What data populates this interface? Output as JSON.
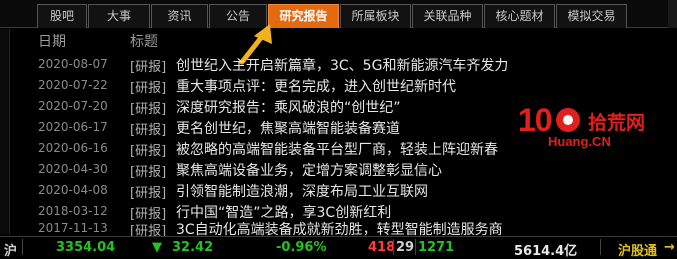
{
  "tabs": [
    {
      "label": "股吧",
      "active": false
    },
    {
      "label": "大事",
      "active": false
    },
    {
      "label": "资讯",
      "active": false
    },
    {
      "label": "公告",
      "active": false
    },
    {
      "label": "研究报告",
      "active": true
    },
    {
      "label": "所属板块",
      "active": false
    },
    {
      "label": "关联品种",
      "active": false
    },
    {
      "label": "核心题材",
      "active": false
    },
    {
      "label": "模拟交易",
      "active": false
    }
  ],
  "table": {
    "col_date": "日期",
    "col_title": "标题",
    "rows": [
      {
        "date": "2020-08-07",
        "tag": "[研报]",
        "title": "创世纪入主开启新篇章，3C、5G和新能源汽车齐发力"
      },
      {
        "date": "2020-07-22",
        "tag": "[研报]",
        "title": "重大事项点评：更名完成，进入创世纪新时代"
      },
      {
        "date": "2020-07-20",
        "tag": "[研报]",
        "title": "深度研究报告：乘风破浪的“创世纪”"
      },
      {
        "date": "2020-06-17",
        "tag": "[研报]",
        "title": "更名创世纪，焦聚高端智能装备赛道"
      },
      {
        "date": "2020-06-16",
        "tag": "[研报]",
        "title": "被忽略的高端智能装备平台型厂商，轻装上阵迎新春"
      },
      {
        "date": "2020-04-30",
        "tag": "[研报]",
        "title": "聚焦高端设备业务，定增方案调整彰显信心"
      },
      {
        "date": "2020-04-08",
        "tag": "[研报]",
        "title": "引领智能制造浪潮，深度布局工业互联网"
      },
      {
        "date": "2018-03-12",
        "tag": "[研报]",
        "title": "行中国“智造”之路，享3C创新红利"
      },
      {
        "date": "2017-11-13",
        "tag": "[研报]",
        "title": "3C自动化高端装备成就新劲胜，转型智能制造服务商"
      }
    ]
  },
  "watermark": {
    "number": "10",
    "cn": "拾荒网",
    "url": "Huang.CN"
  },
  "status": {
    "market": "沪",
    "index": "3354.04",
    "change_arrow": "▼",
    "change": "32.42",
    "change_pct": "-0.96%",
    "up_count": "418",
    "flat_count": "29",
    "down_count": "1271",
    "turnover": "5614.4亿",
    "connect": "沪股通",
    "connect_arrow": "→"
  },
  "colors": {
    "accent_tab": "#e46a12",
    "up": "#ff3b3b",
    "down": "#22c322",
    "text": "#c0c0c0"
  }
}
